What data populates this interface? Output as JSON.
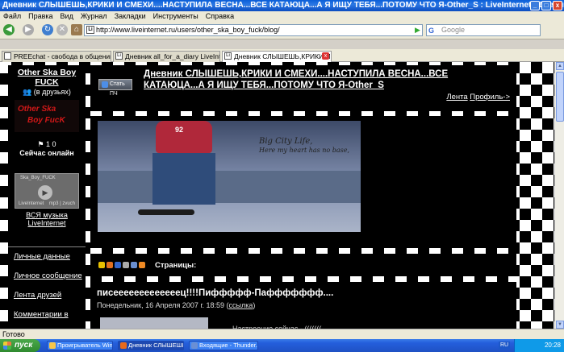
{
  "window": {
    "title": "Дневник СЛЫШЕШЬ,КРИКИ И СМЕХИ....НАСТУПИЛА ВЕСНА...ВСЕ КАТАЮЦА...А Я ИЩУ ТЕБЯ...ПОТОМУ ЧТО Я-Other_S : LiveInternet - Дневники,Новости,Форумы - Mozilla Firefox",
    "min_label": "_",
    "max_label": "□",
    "close_label": "x"
  },
  "menu": [
    "Файл",
    "Правка",
    "Вид",
    "Журнал",
    "Закладки",
    "Инструменты",
    "Справка"
  ],
  "nav": {
    "back_icon": "arrow-left-icon",
    "url": "http://www.liveinternet.ru/users/other_ska_boy_fuck/blog/",
    "url_favicon": "Li",
    "search_placeholder": "Google",
    "search_logo": "G"
  },
  "tabs": [
    {
      "label": "PREEchat - свобода в общении!!!",
      "icon": ""
    },
    {
      "label": "Дневник all_for_a_diary LiveInternet ...",
      "icon": "Li"
    },
    {
      "label": "Дневник СЛЫШЕШЬ,КРИКИ И СМ...",
      "icon": "Li",
      "close": "x"
    }
  ],
  "sidebar": {
    "username": "Other Ska Boy FUCK",
    "friends": "(в друзьях)",
    "avatar_line1": "Other Ska",
    "avatar_line2": "Boy FucK",
    "stats": "1 0",
    "online": "Сейчас онлайн",
    "player_title": "Ska_Boy_FUCK",
    "player_li": "LiveInternet",
    "player_mp": "mp3 | zvuch",
    "music_link": "ВСЯ музыка LiveInternet",
    "links": [
      "Личные данные",
      "Личное сообщение",
      "Лента друзей",
      "Комментарии в"
    ]
  },
  "header": {
    "subscribe_label": "Стать ПЧ",
    "diary_title": "Дневник СЛЫШЕШЬ,КРИКИ И СМЕХИ....НАСТУПИЛА ВЕСНА...ВСЕ КАТАЮЦА...А Я ИЩУ ТЕБЯ...ПОТОМУ ЧТО Я-Other_S",
    "link_feed": "Лента",
    "link_profile": "Профиль->"
  },
  "banner": {
    "shirt_number": "92",
    "caption1": "Big City Life,",
    "caption2": "Here my heart has no base,"
  },
  "pages": {
    "label": "Страницы:"
  },
  "post": {
    "title": "писееееееееееееец!!!!Пиффффф-Паффффффф....",
    "date": "Понедельник, 16 Апреля 2007 г. 18:59 (",
    "link": "ссылка",
    "date_end": ")",
    "mood": "Настроение сейчас - ((((((("
  },
  "status": "Готово",
  "taskbar": {
    "start": "пуск",
    "tasks": [
      "Проигрыватель Win...",
      "Дневник СЛЫШЕШЬ...",
      "Входящие - Thunder..."
    ],
    "lang": "RU",
    "clock": "20:28"
  }
}
